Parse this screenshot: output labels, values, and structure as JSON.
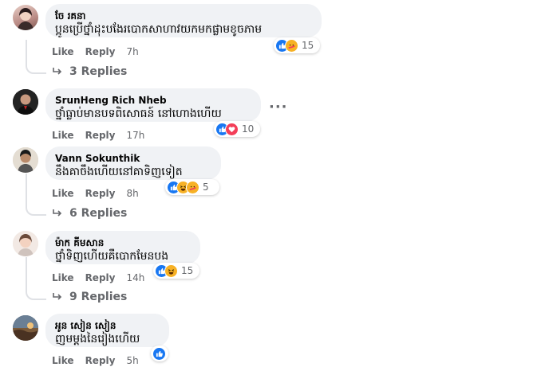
{
  "comments": [
    {
      "author": "ចែ រគនា",
      "text": "ប្អូនប្រើថ្នាំដុះបងែរបោកសាហាវយកមកផ្លាមខូចភាម",
      "like_label": "Like",
      "reply_label": "Reply",
      "time": "7h",
      "reaction_count": "15",
      "reactions": [
        "like-icon",
        "care-icon"
      ],
      "replies_label": "3 Replies"
    },
    {
      "author": "SrunHeng Rich Nheb",
      "text": "ថ្នាំធ្លាប់មានបទពិសោធន៍ នៅហោងហើយ",
      "like_label": "Like",
      "reply_label": "Reply",
      "time": "17h",
      "reaction_count": "10",
      "reactions": [
        "like-icon",
        "love-icon"
      ],
      "more_label": "···"
    },
    {
      "author": "Vann Sokunthik",
      "text": "នឹងគាចឹងហើយនៅគាទិញទៀត",
      "like_label": "Like",
      "reply_label": "Reply",
      "time": "8h",
      "reaction_count": "5",
      "reactions": [
        "like-icon",
        "haha-icon",
        "care-icon"
      ],
      "replies_label": "6 Replies"
    },
    {
      "author": "ម៉ាក គីមសាន",
      "text": "ថ្នាំទិញហើយគឺបោកមែនបង",
      "like_label": "Like",
      "reply_label": "Reply",
      "time": "14h",
      "reaction_count": "15",
      "reactions": [
        "like-icon",
        "haha-icon"
      ],
      "replies_label": "9 Replies"
    },
    {
      "author": "អូន សៀន សៀន",
      "text": "ញមម្តងនៃរៀងហើយ",
      "like_label": "Like",
      "reply_label": "Reply",
      "time": "5h",
      "reaction_count": "",
      "reactions": [
        "like-icon"
      ]
    }
  ],
  "colors": {
    "like": "#1877f2",
    "love": "#f33e58",
    "haha": "#f7b125",
    "muted": "#65676b",
    "bubble": "#f0f2f5"
  }
}
